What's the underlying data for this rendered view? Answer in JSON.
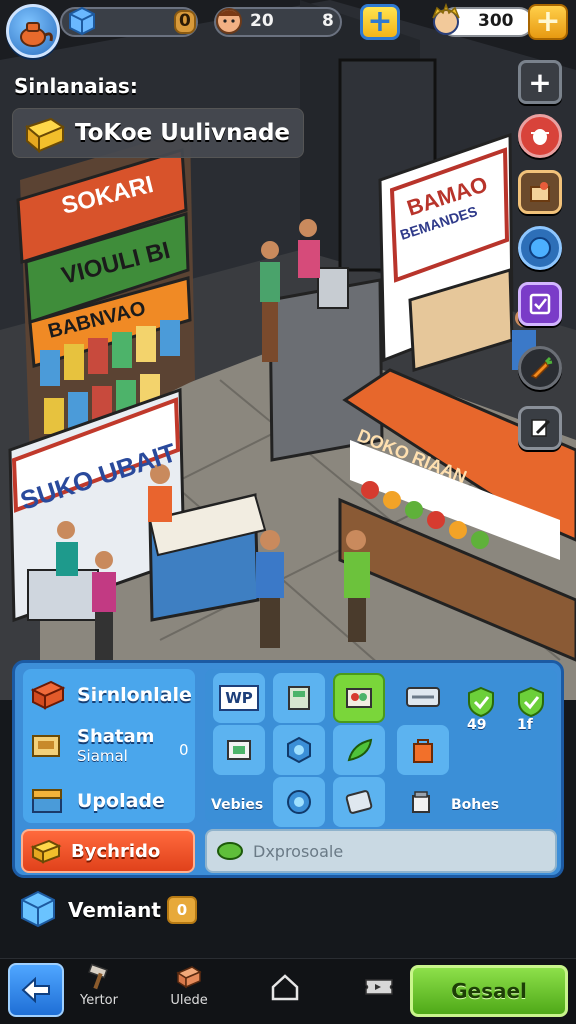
{
  "hud": {
    "blue_pill_value": "0",
    "character_level": "20",
    "character_count": "8",
    "coins": "300"
  },
  "header": {
    "section_label": "Sinlanaias:",
    "shop_name": "ToKoe Uulivnade"
  },
  "scene_signs": {
    "left_top": "SOKARI",
    "left_mid": "VIOULI BI",
    "left_green": "BABNVAO",
    "right_top": "BAMAO",
    "right_sub": "BEMANDES",
    "center": "SUKO UBAIT",
    "stall": "DOKO RIAAN"
  },
  "panel": {
    "left_items": [
      {
        "label": "Sirnlonlale",
        "icon": "crate-icon"
      },
      {
        "label": "Shatam",
        "sub": "Siamal",
        "value": "0",
        "icon": "box-icon"
      },
      {
        "label": "Upolade",
        "icon": "chest-icon"
      }
    ],
    "grid_labels": {
      "wp": "WP",
      "bottom_left": "Vebies",
      "bottom_right": "Bohes",
      "count_a": "49",
      "count_b": "1f"
    },
    "red_button": "Bychrido",
    "green_field": "Dxprosoale"
  },
  "variant": {
    "label": "Vemiant",
    "badge": "0"
  },
  "nav": {
    "items": [
      {
        "label": "Yertor",
        "icon": "hammer-icon"
      },
      {
        "label": "Ulede",
        "icon": "crate-icon"
      },
      {
        "label": "",
        "icon": "home-icon"
      },
      {
        "label": "",
        "icon": "ticket-icon"
      }
    ],
    "cancel": "Gesael"
  },
  "colors": {
    "panel_blue": "#3d8ed8",
    "accent_green": "#7ad63a",
    "accent_red": "#e0421b",
    "gold": "#f3b51a"
  }
}
